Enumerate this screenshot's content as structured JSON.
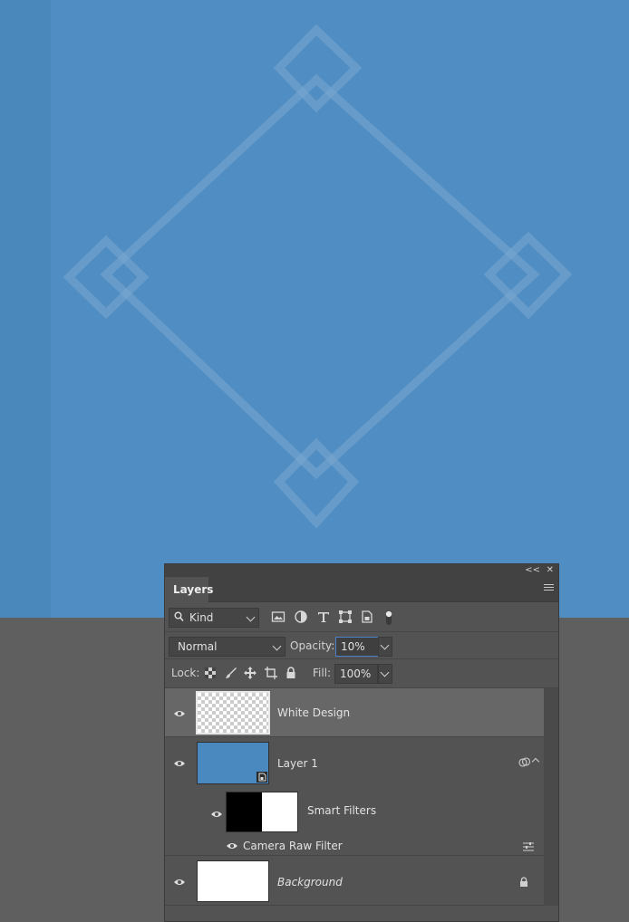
{
  "canvas": {
    "background_color": "#4f8dc3",
    "pattern_color": "#7aa8d0"
  },
  "panel": {
    "collapse_label": "<<",
    "close_label": "✕",
    "tab_label": "Layers",
    "menu_icon": "panel-menu-icon"
  },
  "filter": {
    "kind_label": "Kind",
    "icons": [
      "pixel-filter-icon",
      "adjustment-filter-icon",
      "type-filter-icon",
      "shape-filter-icon",
      "smart-object-filter-icon",
      "filter-toggle-icon"
    ]
  },
  "blend": {
    "mode": "Normal",
    "opacity_label": "Opacity:",
    "opacity_value": "10%"
  },
  "lock": {
    "label": "Lock:",
    "fill_label": "Fill:",
    "fill_value": "100%",
    "icons": [
      "lock-transparent-icon",
      "lock-image-icon",
      "lock-position-icon",
      "lock-artboard-icon",
      "lock-all-icon"
    ]
  },
  "layers": [
    {
      "name": "White Design",
      "selected": true
    },
    {
      "name": "Layer 1",
      "selected": false,
      "thumb_color": "#4a89c0"
    },
    {
      "name": "Smart Filters"
    },
    {
      "name": "Camera Raw Filter"
    },
    {
      "name": "Background",
      "italic": true
    }
  ]
}
